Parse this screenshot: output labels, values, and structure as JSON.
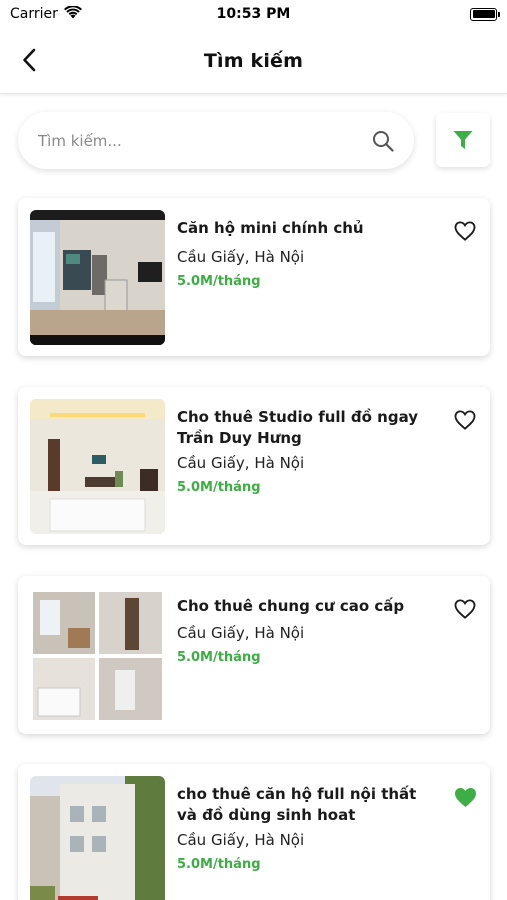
{
  "status_bar": {
    "carrier": "Carrier",
    "time": "10:53 PM"
  },
  "header": {
    "title": "Tìm kiếm"
  },
  "search": {
    "placeholder": "Tìm kiếm...",
    "value": ""
  },
  "colors": {
    "accent": "#3cae44"
  },
  "listings": [
    {
      "title": "Căn hộ mini chính chủ",
      "location": "Cầu Giấy, Hà Nội",
      "price": "5.0M/tháng",
      "favorited": false
    },
    {
      "title": "Cho thuê Studio full đồ ngay Trần Duy Hưng",
      "location": "Cầu Giấy, Hà Nội",
      "price": "5.0M/tháng",
      "favorited": false
    },
    {
      "title": "Cho thuê chung cư cao cấp",
      "location": "Cầu Giấy, Hà Nội",
      "price": "5.0M/tháng",
      "favorited": false
    },
    {
      "title": "cho thuê căn hộ full nội thất và đồ dùng sinh hoat",
      "location": "Cầu Giấy, Hà Nội",
      "price": "5.0M/tháng",
      "favorited": true
    }
  ]
}
